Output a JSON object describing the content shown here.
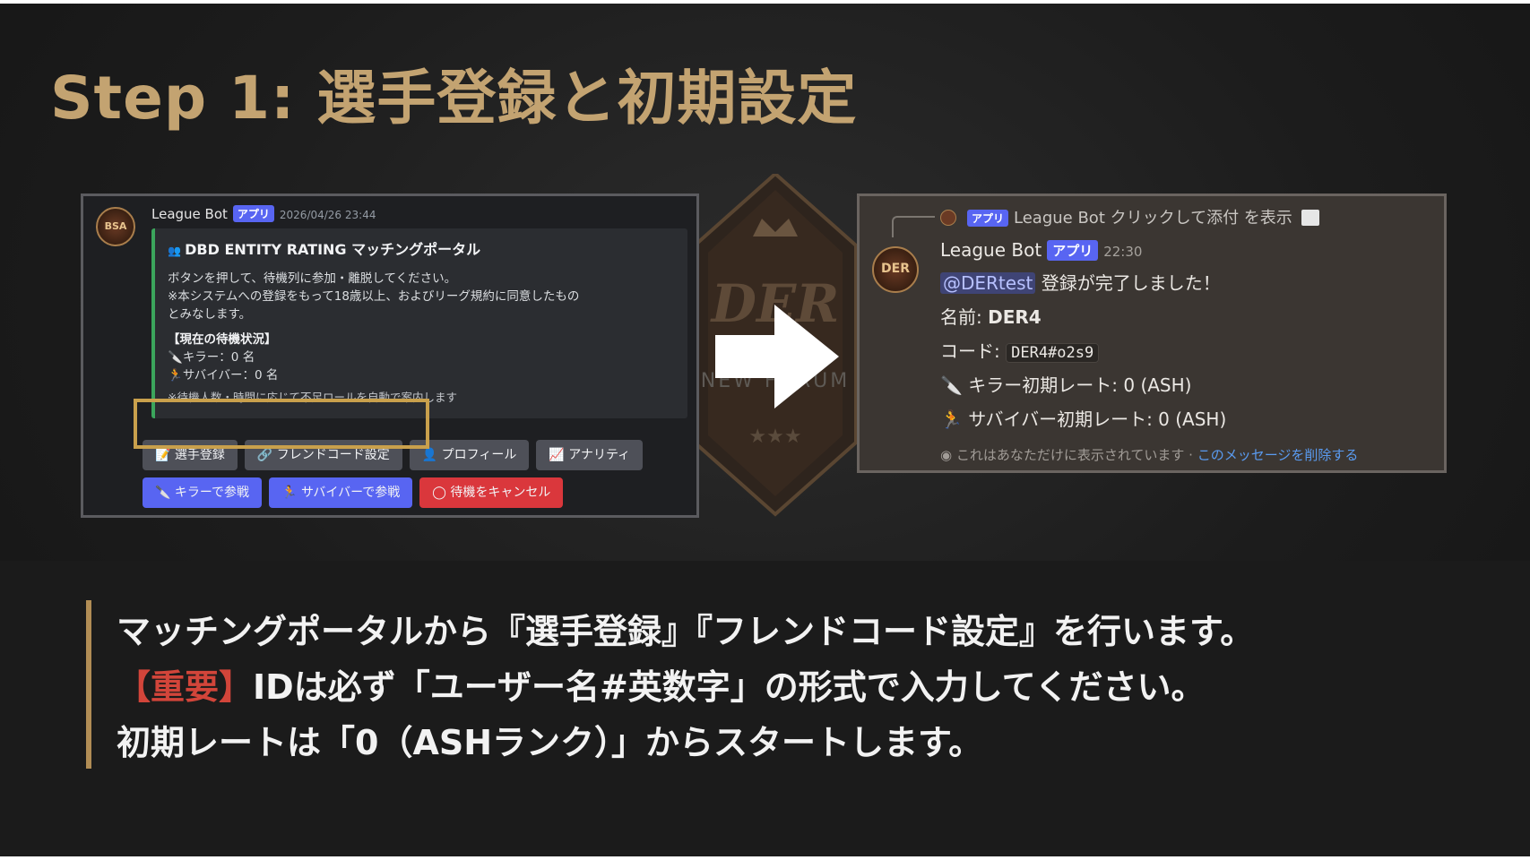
{
  "title": "Step 1: 選手登録と初期設定",
  "left_panel": {
    "avatar_text": "BSA",
    "bot_name": "League Bot",
    "app_badge": "アプリ",
    "timestamp": "2026/04/26 23:44",
    "embed_title": "DBD ENTITY RATING マッチングポータル",
    "embed_line1": "ボタンを押して、待機列に参加・離脱してください。",
    "embed_line2": "※本システムへの登録をもって18歳以上、およびリーグ規約に同意したもの",
    "embed_line3": "とみなします。",
    "status_header": "【現在の待機状況】",
    "killer_line": "キラー：0 名",
    "survivor_line": "サバイバー：0 名",
    "note": "※待機人数・時間に応じて不足ロールを自動で案内します",
    "buttons_row1": [
      "選手登録",
      "フレンドコード設定",
      "プロフィール",
      "アナリティ"
    ],
    "buttons_row2": [
      "キラーで参戦",
      "サバイバーで参戦",
      "待機をキャンセル"
    ]
  },
  "emblem": {
    "text": "DER",
    "subtext": "NEW FORUM"
  },
  "right_panel": {
    "reply_badge": "アプリ",
    "reply_bot": "League Bot",
    "reply_text": "クリックして添付 を表示",
    "avatar_text": "DER",
    "bot_name": "League Bot",
    "app_badge": "アプリ",
    "time": "22:30",
    "mention": "@DERtest",
    "complete": "登録が完了しました！",
    "name_label": "名前:",
    "name_value": "DER4",
    "code_label": "コード:",
    "code_value": "DER4#o2s9",
    "killer_rate": "キラー初期レート: 0 (ASH)",
    "survivor_rate": "サバイバー初期レート: 0 (ASH)",
    "footer_text": "これはあなただけに表示されています ·",
    "footer_link": "このメッセージを削除する"
  },
  "caption": {
    "line1": "マッチングポータルから『選手登録』『フレンドコード設定』を行います。",
    "line2_important": "【重要】",
    "line2_rest": "IDは必ず「ユーザー名#英数字」の形式で入力してください。",
    "line3": "初期レートは「0（ASHランク）」からスタートします。"
  },
  "colors": {
    "title": "#c3a371",
    "accent_bar": "#b18d55",
    "highlight_box": "#c9a04c",
    "important": "#d2453a",
    "discord_blurple": "#5865f2",
    "embed_green": "#3ba55c"
  }
}
